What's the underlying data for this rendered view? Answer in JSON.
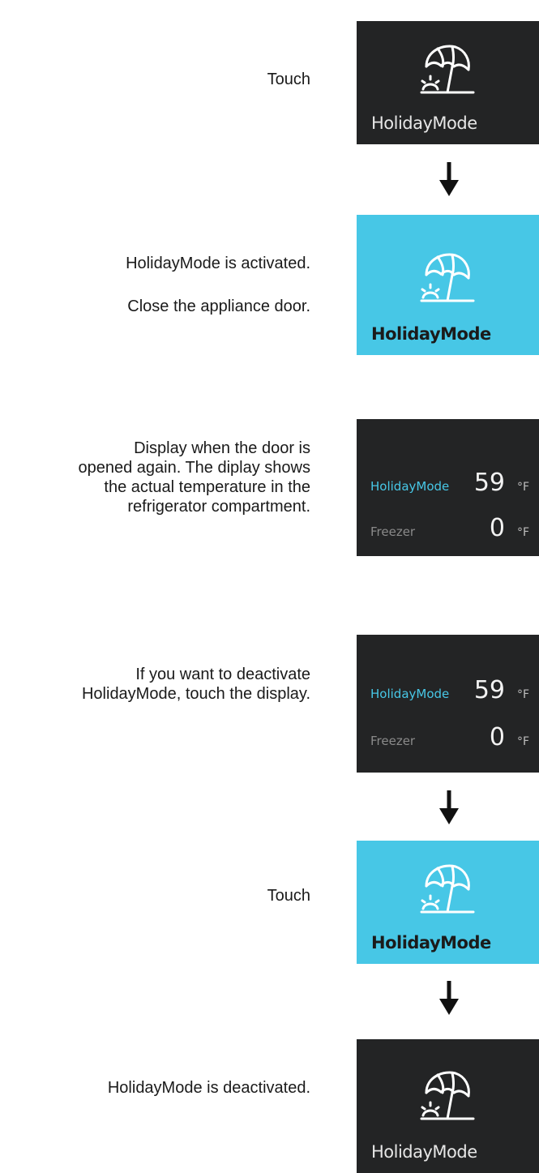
{
  "steps": {
    "s1": {
      "text": "Touch",
      "panel_label": "HolidayMode",
      "icon": "beach-umbrella-sun-icon"
    },
    "s2": {
      "line1": "HolidayMode is activated.",
      "line2": "Close the appliance door.",
      "panel_label": "HolidayMode",
      "icon": "beach-umbrella-sun-icon"
    },
    "s3": {
      "text": "Display when the door is\nopened again. The diplay shows\nthe actual temperature in the\nrefrigerator compartment.",
      "rows": [
        {
          "name": "HolidayMode",
          "value": "59",
          "unit": "°F"
        },
        {
          "name": "Freezer",
          "value": "0",
          "unit": "°F"
        }
      ]
    },
    "s4": {
      "text": "If you want to deactivate\nHolidayMode, touch the display.",
      "rows": [
        {
          "name": "HolidayMode",
          "value": "59",
          "unit": "°F"
        },
        {
          "name": "Freezer",
          "value": "0",
          "unit": "°F"
        }
      ]
    },
    "s5": {
      "text": "Touch",
      "panel_label": "HolidayMode",
      "icon": "beach-umbrella-sun-icon"
    },
    "s6": {
      "text": "HolidayMode is deactivated.",
      "panel_label": "HolidayMode",
      "icon": "beach-umbrella-sun-icon"
    }
  },
  "colors": {
    "dark_panel": "#232425",
    "accent_blue": "#47c7e6",
    "text": "#1a1a1a"
  },
  "arrow_icon": "down-arrow-icon"
}
